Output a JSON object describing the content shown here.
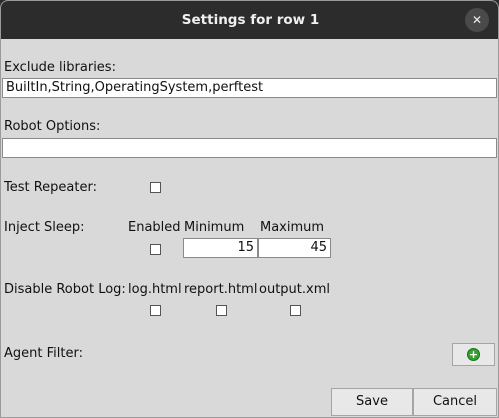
{
  "dialog": {
    "title": "Settings for row 1",
    "close_icon": "close-icon"
  },
  "exclude_libraries": {
    "label": "Exclude libraries:",
    "value": "BuiltIn,String,OperatingSystem,perftest"
  },
  "robot_options": {
    "label": "Robot Options:",
    "value": ""
  },
  "test_repeater": {
    "label": "Test Repeater:",
    "checked": false
  },
  "inject_sleep": {
    "label": "Inject Sleep:",
    "enabled_header": "Enabled",
    "minimum_header": "Minimum",
    "maximum_header": "Maximum",
    "enabled": false,
    "minimum": "15",
    "maximum": "45"
  },
  "disable_robot_log": {
    "label": "Disable Robot Log:",
    "options": [
      {
        "label": "log.html",
        "checked": false
      },
      {
        "label": "report.html",
        "checked": false
      },
      {
        "label": "output.xml",
        "checked": false
      }
    ]
  },
  "agent_filter": {
    "label": "Agent Filter:",
    "add_icon": "plus-circle-icon",
    "add_color": "#35a02c"
  },
  "buttons": {
    "save": "Save",
    "cancel": "Cancel"
  }
}
